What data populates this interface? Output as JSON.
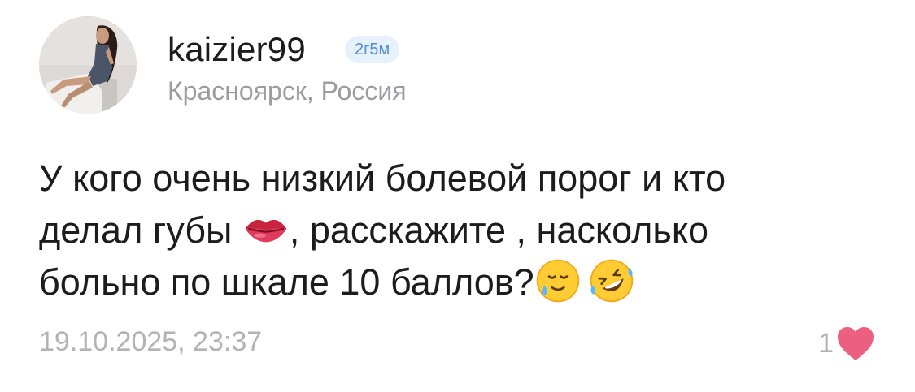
{
  "author": {
    "username": "kaizier99",
    "age_badge": "2г5м",
    "location": "Красноярск, Россия",
    "avatar_icon": "profile-photo"
  },
  "post": {
    "line1": "У кого очень низкий болевой порог и кто",
    "line2_before": "делал губы ",
    "line2_after": ", расскажите , насколько",
    "line3_text": "больно по шкале 10 баллов?",
    "emojis": [
      "lips-emoji",
      "smiling-face-with-tear-emoji",
      "rolling-on-floor-laughing-emoji"
    ]
  },
  "footer": {
    "timestamp": "19.10.2025, 23:37",
    "like_count": "1",
    "like_icon": "heart-icon",
    "like_color": "#ec5f7e"
  }
}
